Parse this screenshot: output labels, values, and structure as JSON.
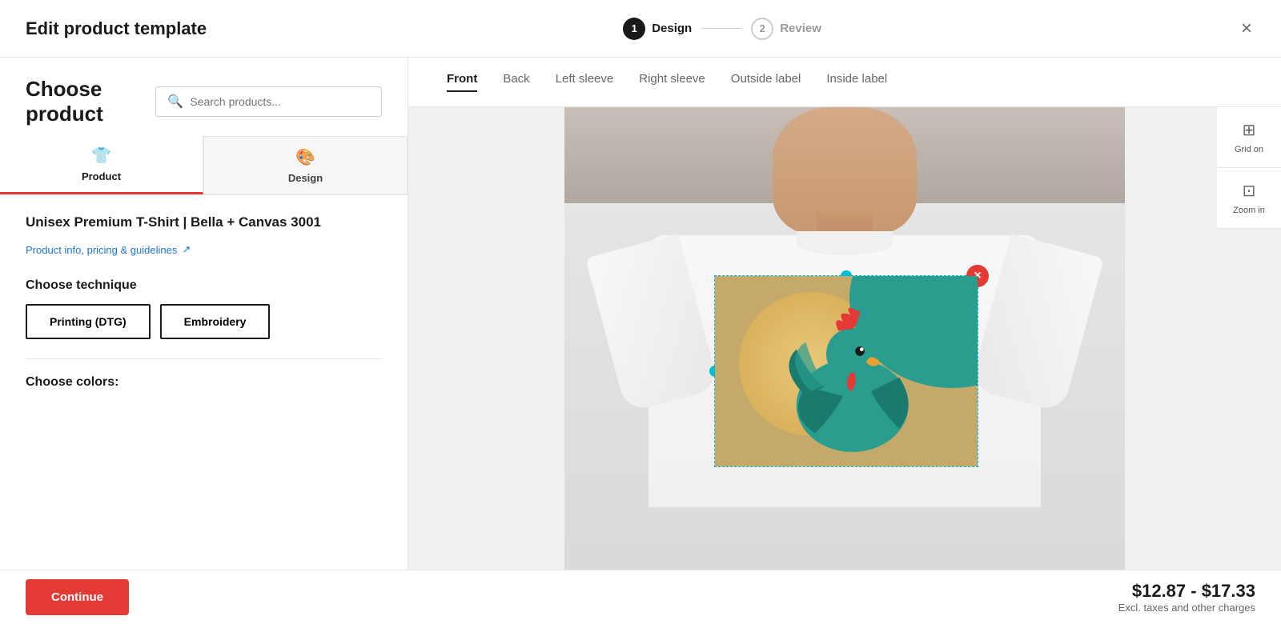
{
  "header": {
    "title": "Edit product template",
    "close_label": "×",
    "stepper": {
      "step1": {
        "number": "1",
        "label": "Design",
        "active": true
      },
      "step2": {
        "number": "2",
        "label": "Review",
        "active": false
      }
    }
  },
  "left_panel": {
    "choose_product_title": "Choose product",
    "search": {
      "placeholder": "Search products..."
    },
    "tabs": [
      {
        "id": "product",
        "label": "Product",
        "icon": "👕",
        "active": true
      },
      {
        "id": "design",
        "label": "Design",
        "icon": "🎨",
        "active": false
      }
    ],
    "product_name": "Unisex Premium T-Shirt | Bella + Canvas 3001",
    "product_link_label": "Product info, pricing & guidelines",
    "product_link_icon": "↗",
    "technique": {
      "title": "Choose technique",
      "options": [
        {
          "id": "dtg",
          "label": "Printing (DTG)",
          "active": true
        },
        {
          "id": "embroidery",
          "label": "Embroidery",
          "active": false
        }
      ]
    },
    "colors_title": "Choose colors:"
  },
  "right_panel": {
    "view_tabs": [
      {
        "id": "front",
        "label": "Front",
        "active": true
      },
      {
        "id": "back",
        "label": "Back",
        "active": false
      },
      {
        "id": "left_sleeve",
        "label": "Left sleeve",
        "active": false
      },
      {
        "id": "right_sleeve",
        "label": "Right sleeve",
        "active": false
      },
      {
        "id": "outside_label",
        "label": "Outside label",
        "active": false
      },
      {
        "id": "inside_label",
        "label": "Inside label",
        "active": false
      }
    ],
    "tools": [
      {
        "id": "grid",
        "icon": "⊞",
        "label": "Grid on"
      },
      {
        "id": "zoom",
        "icon": "⊡",
        "label": "Zoom in"
      }
    ]
  },
  "footer": {
    "continue_label": "Continue",
    "price_range": "$12.87 - $17.33",
    "price_note": "Excl. taxes and other charges"
  }
}
